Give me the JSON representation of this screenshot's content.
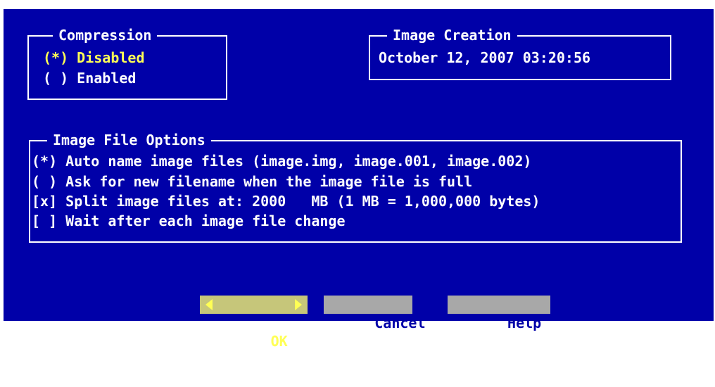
{
  "colors": {
    "background": "#0000a8",
    "foreground": "#ffffff",
    "selected": "#ffff55",
    "button_bg": "#a8a8a8",
    "button_focus_bg": "#c6c67a"
  },
  "compression": {
    "title": "Compression",
    "options": [
      {
        "label": "(*) Disabled",
        "selected": true
      },
      {
        "label": "( ) Enabled",
        "selected": false
      }
    ]
  },
  "image_creation": {
    "title": "Image Creation",
    "value": "October 12, 2007 03:20:56"
  },
  "image_file_options": {
    "title": "Image File Options",
    "options": [
      {
        "label": "(*) Auto name image files (image.img, image.001, image.002)",
        "checked": true
      },
      {
        "label": "( ) Ask for new filename when the image file is full",
        "checked": false
      },
      {
        "label": "[x] Split image files at: 2000   MB (1 MB = 1,000,000 bytes)",
        "checked": true
      },
      {
        "label": "[ ] Wait after each image file change",
        "checked": false
      }
    ]
  },
  "buttons": {
    "ok": "OK",
    "cancel": "Cancel",
    "help": "Help",
    "focused": "ok",
    "focus_arrow_icons": [
      "arrow-left-icon",
      "arrow-right-icon"
    ]
  }
}
